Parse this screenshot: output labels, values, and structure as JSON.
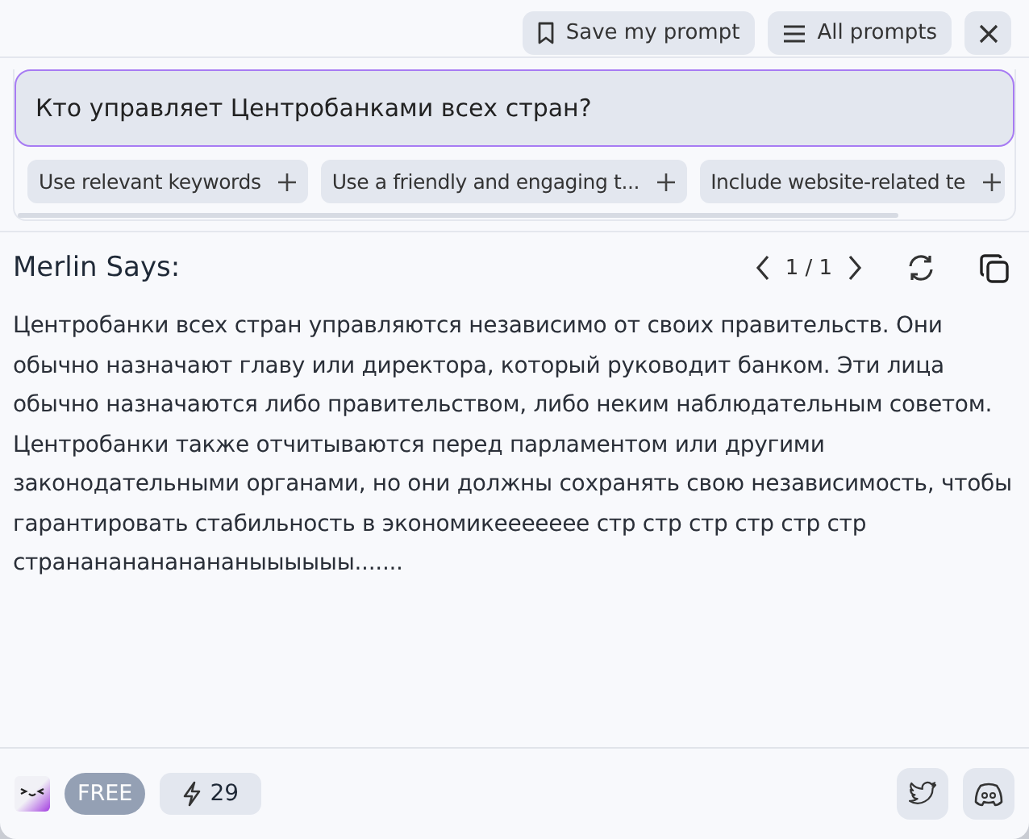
{
  "header": {
    "buttons": [
      {
        "kind": "save",
        "label": "Save my prompt"
      },
      {
        "kind": "list",
        "label": "All prompts"
      },
      {
        "kind": "close"
      }
    ]
  },
  "prompt": {
    "value": "Кто управляет Центробанками всех стран?"
  },
  "suggestions": [
    "Use relevant keywords",
    "Use a friendly and engaging t...",
    "Include website-related te"
  ],
  "answer": {
    "title": "Merlin Says:",
    "pager": "1 / 1",
    "text": "Центробанки всех стран управляются независимо от своих правительств. Они обычно назначают главу или директора, который руководит банком. Эти лица обычно назначаются либо правительством, либо неким наблюдательным советом. Центробанки также отчитываются перед парламентом или другими законодательными органами, но они должны сохранять свою независимость, чтобы гарантировать стабильность в экономикеееееее стр стр стр стр стр стр странананананананыыыыыы......."
  },
  "footer": {
    "plan": "FREE",
    "credits": "29",
    "links": [
      {
        "kind": "twitter"
      },
      {
        "kind": "discord"
      }
    ]
  }
}
